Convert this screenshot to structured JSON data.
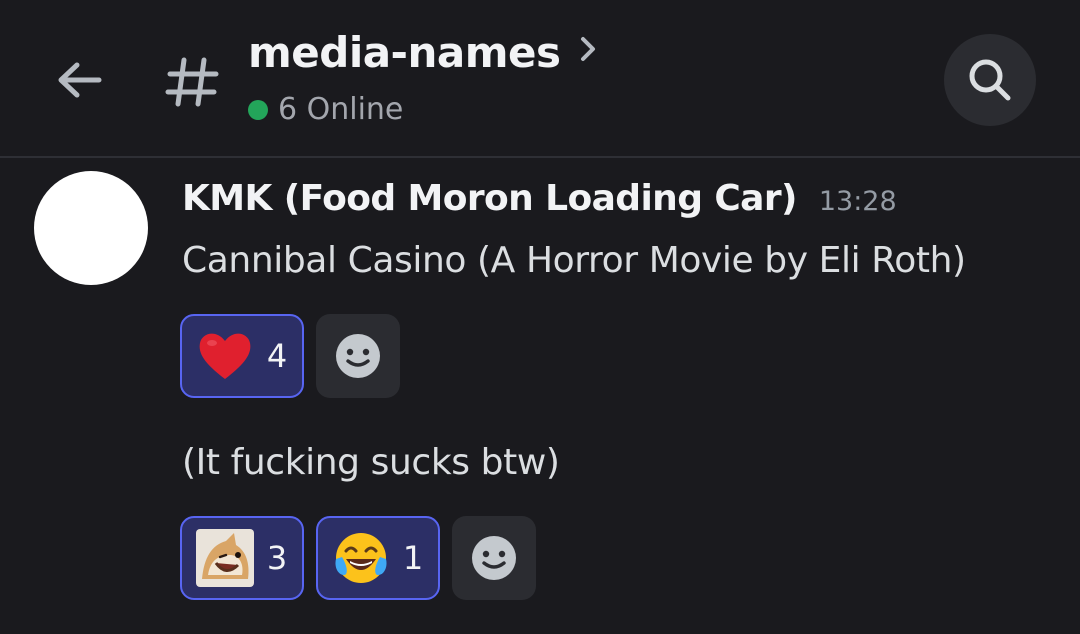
{
  "header": {
    "back_icon": "arrow-left-icon",
    "channel_icon": "hash-icon",
    "channel_name": "media-names",
    "online_count_label": "6 Online",
    "search_icon": "search-icon"
  },
  "colors": {
    "background": "#1a1a1e",
    "online": "#23a55a",
    "reaction_active_bg": "#2c2f66",
    "reaction_active_border": "#5865f2",
    "button_bg": "#2b2c31"
  },
  "message": {
    "author": "KMK (Food Moron Loading Car)",
    "timestamp": "13:28",
    "lines": [
      {
        "text": "Cannibal Casino (A Horror Movie by Eli Roth)",
        "reactions": [
          {
            "emoji": "red-heart-icon",
            "count": "4"
          }
        ]
      },
      {
        "text": "(It fucking sucks btw)",
        "reactions": [
          {
            "emoji": "laughing-doge-icon",
            "count": "3"
          },
          {
            "emoji": "tears-of-joy-icon",
            "count": "1"
          }
        ]
      }
    ]
  },
  "add_reaction_icon": "add-reaction-smile-icon"
}
